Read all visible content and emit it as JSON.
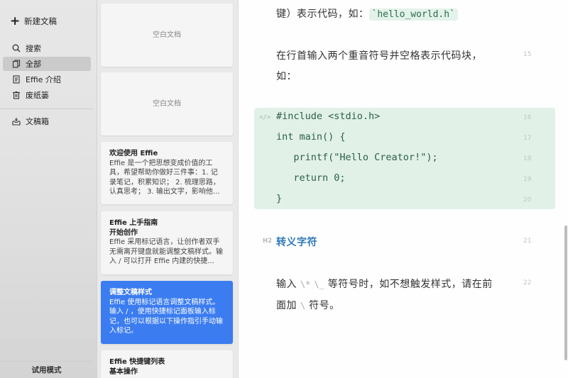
{
  "sidebar": {
    "new_doc": "新建文稿",
    "search": "搜索",
    "all": "全部",
    "effie_intro": "Effie 介绍",
    "trash": "废纸篓",
    "drafts": "文稿箱",
    "trial_mode": "试用模式"
  },
  "doc_list": {
    "blank_1": "空白文档",
    "blank_2": "空白文档",
    "card3": {
      "title": "欢迎使用 Effie",
      "excerpt": "Effie 是一个把思想变成价值的工具，希望帮助你做好三件事：1. 记录笔记，积累知识； 2. 梳理思路，认真思考； 3. 输出文字，影响他..."
    },
    "card4": {
      "title1": "Effie 上手指南",
      "title2": "开始创作",
      "excerpt": "Effie 采用标记语言，让创作者双手无需离开键盘就能调整文稿样式。输入 / 可以打开 Effie 内建的快捷..."
    },
    "card5": {
      "title": "调整文稿样式",
      "excerpt": "Effie 使用标记语言调整文稿样式。输入 / ，使用快捷标记面板输入标记，也可以根据以下操作指引手动输入标记。"
    },
    "card6": {
      "title1": "Effie 快捷键列表",
      "title2": "基本操作"
    }
  },
  "editor": {
    "line_top": {
      "pre": "键）表示代码，如：",
      "code": "`hello_world.h`"
    },
    "para1": "在行首输入两个重音符号并空格表示代码块，",
    "para1b": "如：",
    "code_tag": "</>",
    "code_lines": [
      "#include <stdio.h>",
      "int main() {",
      "   printf(\"Hello Creator!\");",
      "   return 0;",
      "}"
    ],
    "heading_marker": "H2",
    "heading": "转义字符",
    "para2_pre": "输入 ",
    "para2_esc1": "\\*",
    "para2_mid": " ",
    "para2_esc2": "\\_",
    "para2_post": " 等符号时，如不想触发样式，请在前",
    "para3_pre": "面加 ",
    "para3_esc": "\\",
    "para3_post": " 符号。",
    "line_numbers": [
      "15",
      "16",
      "17",
      "18",
      "19",
      "20",
      "21",
      "22"
    ]
  }
}
